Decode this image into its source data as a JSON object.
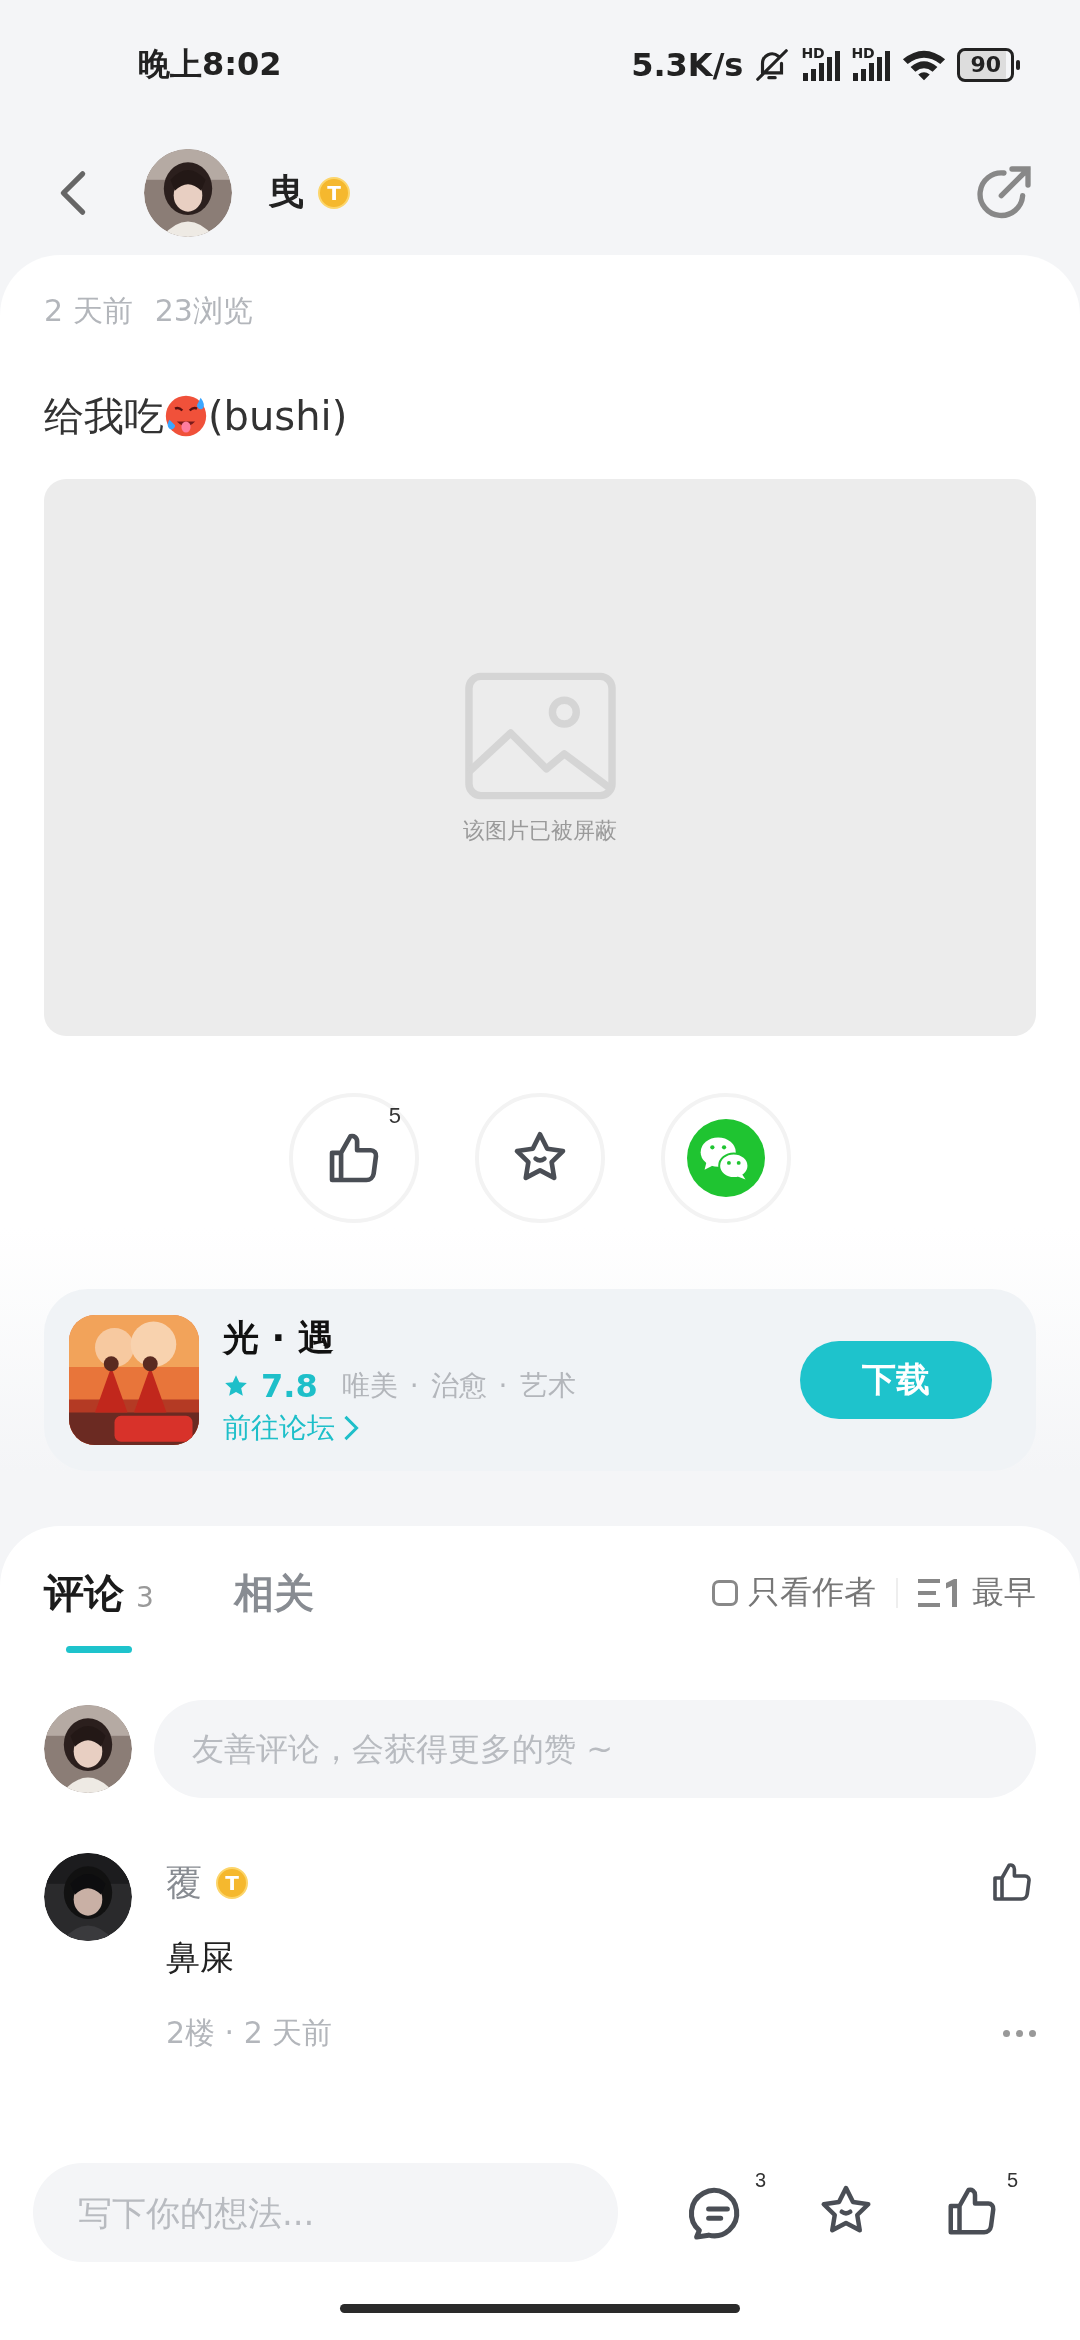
{
  "status_bar": {
    "time": "晚上8:02",
    "net_speed": "5.3K/s",
    "signals": [
      {
        "label": "HD"
      },
      {
        "label": "HD"
      }
    ],
    "battery": "90"
  },
  "header": {
    "author": {
      "name": "曳",
      "badge": "T"
    }
  },
  "post": {
    "meta": [
      "2 天前",
      "23浏览"
    ],
    "text_before": "给我吃",
    "text_after": "(bushi)",
    "blocked_image": {
      "caption": "该图片已被屏蔽"
    },
    "actions": [
      {
        "kind": "like",
        "count": "5"
      },
      {
        "kind": "favorite"
      },
      {
        "kind": "wechat"
      }
    ]
  },
  "game_card": {
    "name": "光 · 遇",
    "rating": "7.8",
    "tags": [
      "唯美",
      "·",
      "治愈",
      "·",
      "艺术"
    ],
    "link": "前往论坛",
    "button": "下载"
  },
  "comments_section": {
    "tabs": [
      {
        "label": "评论",
        "count": "3",
        "selected": true
      },
      {
        "label": "相关",
        "selected": false
      }
    ],
    "author_only": {
      "label": "只看作者",
      "checked": false
    },
    "sort": {
      "label": "最早"
    },
    "comment_input": {
      "placeholder": "友善评论，会获得更多的赞 ~"
    },
    "comments": [
      {
        "name": "覆",
        "badge": "T",
        "text": "鼻屎",
        "meta": "2楼 · 2 天前"
      }
    ]
  },
  "bottom_bar": {
    "placeholder": "写下你的想法...",
    "actions": [
      {
        "kind": "comment",
        "count": "3"
      },
      {
        "kind": "favorite"
      },
      {
        "kind": "like",
        "count": "5"
      }
    ]
  }
}
